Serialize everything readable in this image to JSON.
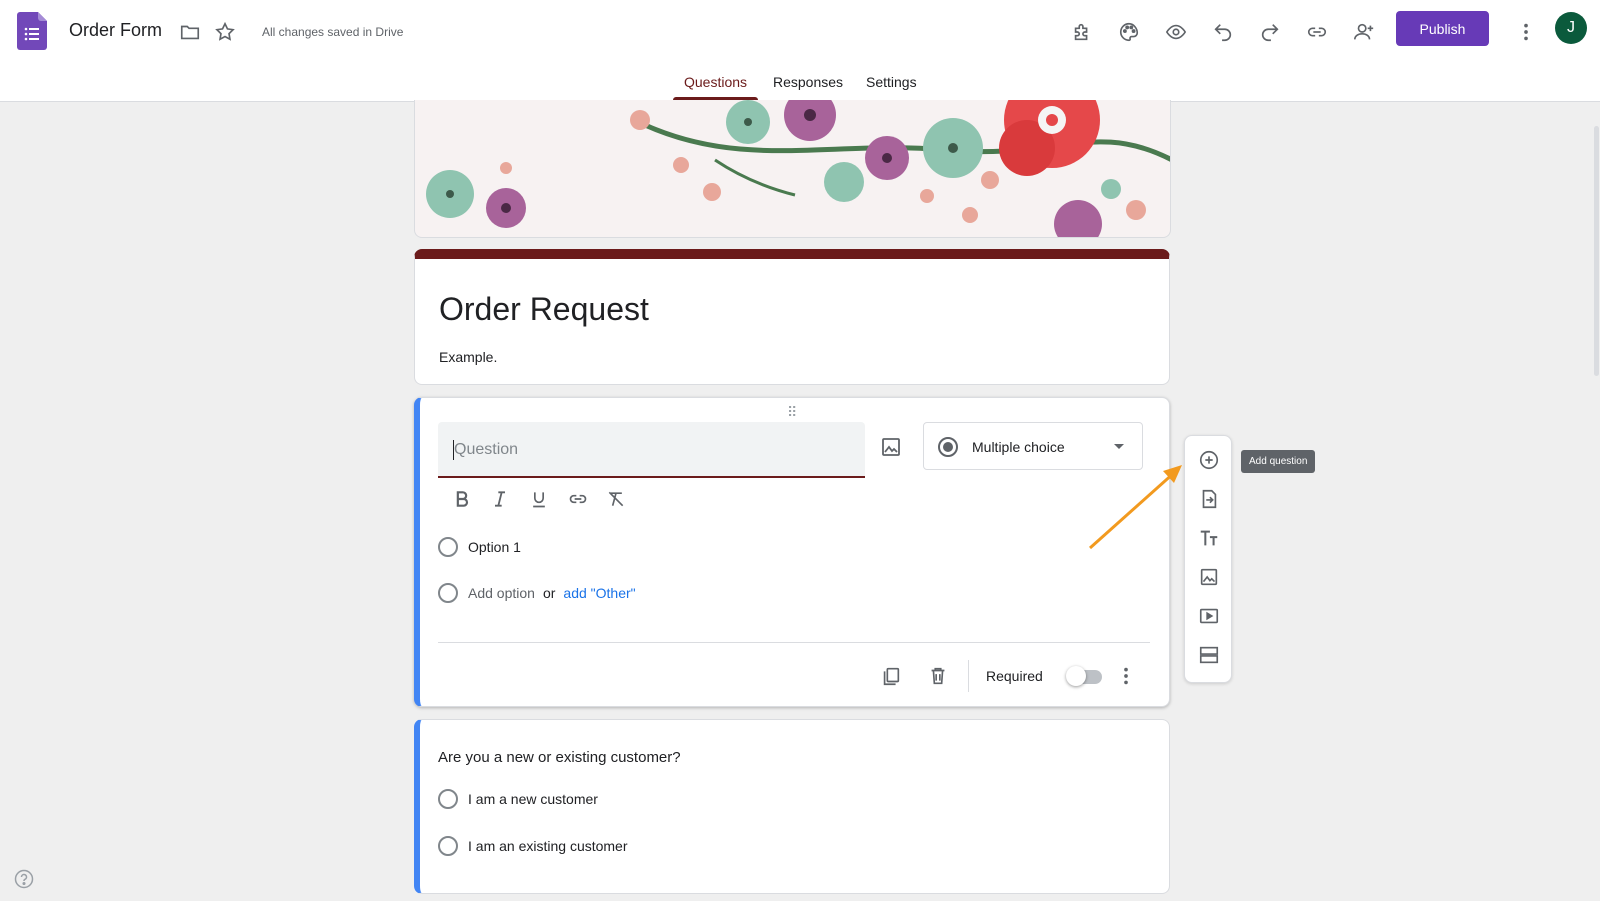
{
  "header": {
    "doc_title": "Order Form",
    "saved_status": "All changes saved in Drive",
    "publish_label": "Publish",
    "avatar_initial": "J"
  },
  "tabs": [
    {
      "label": "Questions",
      "active": true
    },
    {
      "label": "Responses",
      "active": false
    },
    {
      "label": "Settings",
      "active": false
    }
  ],
  "form": {
    "title": "Order Request",
    "description": "Example."
  },
  "question_editor": {
    "placeholder": "Question",
    "type_label": "Multiple choice",
    "options": [
      "Option 1"
    ],
    "add_option": "Add option",
    "or_text": "or",
    "add_other": "add \"Other\"",
    "required_label": "Required",
    "required_on": false
  },
  "question2": {
    "title": "Are you a new or existing customer?",
    "options": [
      "I am a new customer",
      "I am an existing customer"
    ]
  },
  "side_toolbar": {
    "tooltip": "Add question"
  },
  "colors": {
    "theme": "#6b1b1b",
    "publish": "#673ab7",
    "accent_border": "#4285f4",
    "arrow": "#f29a1f"
  }
}
